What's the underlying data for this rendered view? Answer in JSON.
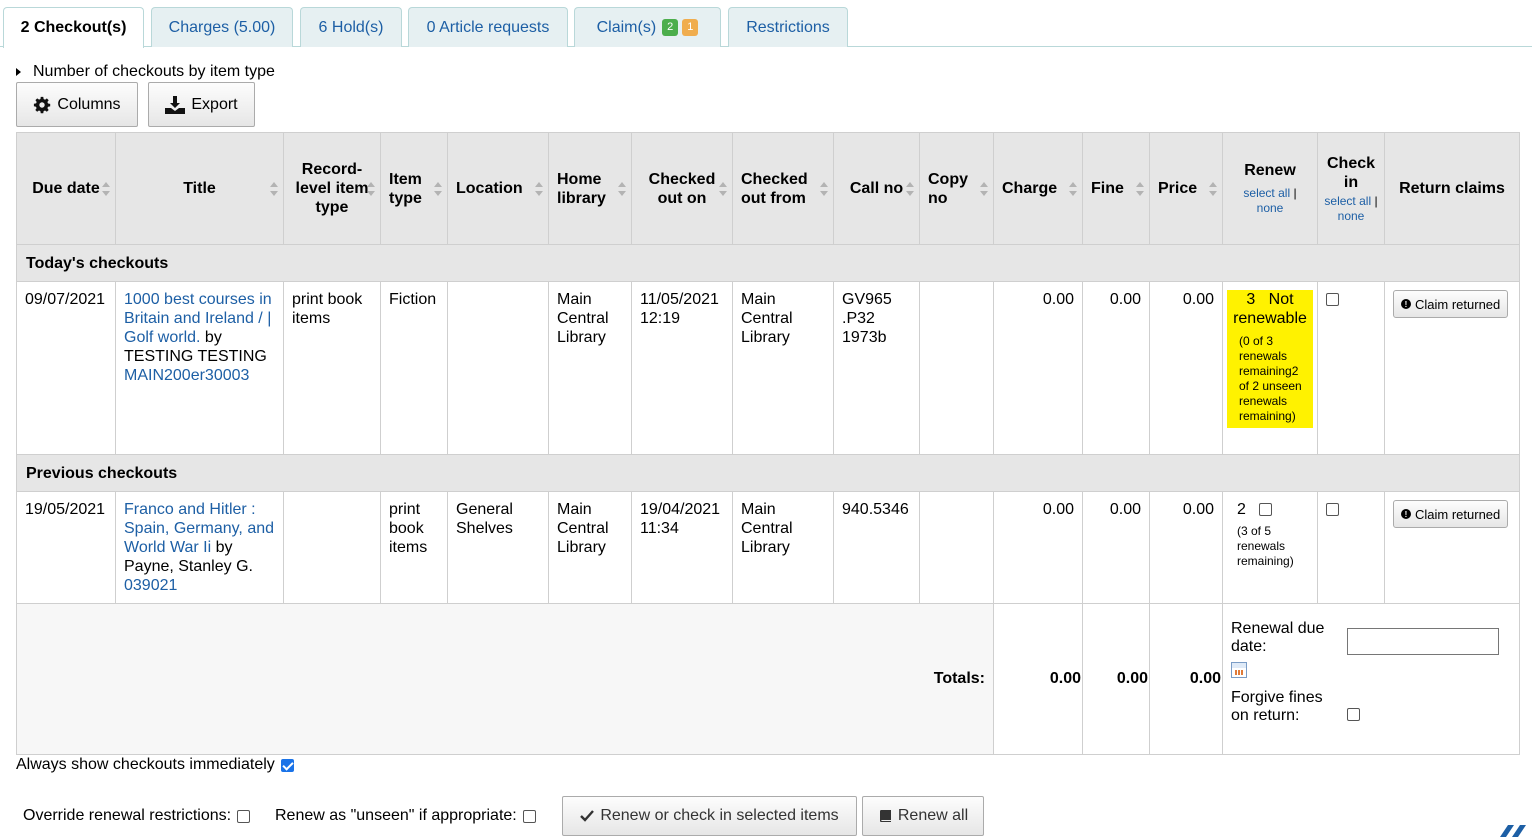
{
  "tabs": [
    {
      "label": "2 Checkout(s)",
      "active": true
    },
    {
      "label": "Charges (5.00)"
    },
    {
      "label": "6 Hold(s)"
    },
    {
      "label": "0 Article requests"
    },
    {
      "label": "Claim(s)",
      "badge_green": "2",
      "badge_orange": "1"
    },
    {
      "label": "Restrictions"
    }
  ],
  "summary_label": "Number of checkouts by item type",
  "toolbar": {
    "columns_label": "Columns",
    "export_label": "Export"
  },
  "table": {
    "headers": {
      "due_date": "Due date",
      "title": "Title",
      "record_level_item_type": "Record-level item type",
      "item_type": "Item type",
      "location": "Location",
      "home_library": "Home library",
      "checked_out_on": "Checked out on",
      "checked_out_from": "Checked out from",
      "call_no": "Call no",
      "copy_no": "Copy no",
      "charge": "Charge",
      "fine": "Fine",
      "price": "Price",
      "renew": "Renew",
      "check_in": "Check in",
      "return_claims": "Return claims",
      "select_all": "select all",
      "none": "none",
      "sep": "|"
    },
    "groups": {
      "today": "Today's checkouts",
      "previous": "Previous checkouts"
    },
    "rows": [
      {
        "due_date": "09/07/2021",
        "title": "1000 best courses in Britain and Ireland / | Golf world.",
        "by": "by",
        "author": "TESTING TESTING",
        "barcode": "MAIN200er30003",
        "record_level_item_type": "print book items",
        "item_type": "Fiction",
        "location": "",
        "home_library": "Main Central Library",
        "checked_out_on": "11/05/2021 12:19",
        "checked_out_from": "Main Central Library",
        "call_no": "GV965 .P32 1973b",
        "copy_no": "",
        "charge": "0.00",
        "fine": "0.00",
        "price": "0.00",
        "renew_count": "3",
        "renew_status": "Not renewable",
        "renew_note": "(0 of 3 renewals remaining2 of 2 unseen renewals remaining)",
        "claim_label": "Claim returned"
      },
      {
        "due_date": "19/05/2021",
        "title": "Franco and Hitler : Spain, Germany, and World War Ii",
        "by": "by",
        "author": "Payne, Stanley G.",
        "barcode": "039021",
        "record_level_item_type": "",
        "item_type": "print book items",
        "location": "General Shelves",
        "home_library": "Main Central Library",
        "checked_out_on": "19/04/2021 11:34",
        "checked_out_from": "Main Central Library",
        "call_no": "940.5346",
        "copy_no": "",
        "charge": "0.00",
        "fine": "0.00",
        "price": "0.00",
        "renew_count": "2",
        "renew_note": "(3 of 5 renewals remaining)",
        "claim_label": "Claim returned"
      }
    ],
    "totals": {
      "label": "Totals:",
      "charge": "0.00",
      "fine": "0.00",
      "price": "0.00"
    },
    "footer": {
      "renewal_due_date_label": "Renewal due date:",
      "forgive_fines_label": "Forgive fines on return:"
    }
  },
  "always_show_label": "Always show checkouts immediately",
  "bottom": {
    "override_label": "Override renewal restrictions:",
    "unseen_label": "Renew as \"unseen\" if appropriate:",
    "renew_checkin_label": "Renew or check in selected items",
    "renew_all_label": "Renew all"
  },
  "colors": {
    "link": "#1d5fa5",
    "highlight": "#fff200",
    "badge_green": "#4cae4c",
    "badge_orange": "#f0ad4e",
    "header_bg": "#e6e6e6"
  }
}
